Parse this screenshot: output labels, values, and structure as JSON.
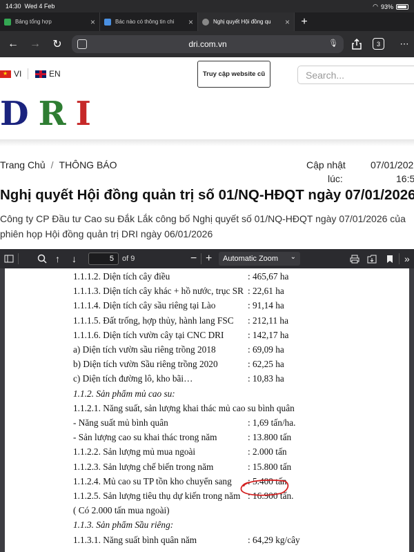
{
  "status_bar": {
    "time": "14:30",
    "date": "Wed 4 Feb",
    "battery": "93%"
  },
  "tabs": [
    {
      "label": "Bảng tổng hợp",
      "icon_color": "#34a853",
      "active": false
    },
    {
      "label": "Bác nào có thông tin chi",
      "icon_color": "#4a90e2",
      "active": false
    },
    {
      "label": "Nghị quyết Hội đồng qu",
      "icon_color": "#888888",
      "active": true
    }
  ],
  "new_tab": "+",
  "toolbar": {
    "url": "dri.com.vn",
    "tab_count": "3"
  },
  "site": {
    "lang_vi": "VI",
    "lang_en": "EN",
    "old_site_button": "Truy cập website cũ",
    "search_placeholder": "Search...",
    "logo": {
      "d": "D",
      "r": "R",
      "i": "I"
    }
  },
  "breadcrumb": {
    "home": "Trang Chủ",
    "separator": "/",
    "current": "THÔNG BÁO"
  },
  "meta": {
    "updated_label": "Cập nhật",
    "updated_value": "07/01/202",
    "time_label": "lúc:",
    "time_value": "16:5"
  },
  "article": {
    "title": "Nghị quyết Hội đồng quản trị số 01/NQ-HĐQT ngày 07/01/2026",
    "summary": "Công ty CP Đầu tư Cao su Đắk Lắk công bố Nghị quyết số 01/NQ-HĐQT ngày 07/01/2026 của phiên họp Hội đồng quản trị DRI ngày 06/01/2026"
  },
  "pdf": {
    "page_number": "5",
    "page_count": "of 9",
    "zoom": "Automatic Zoom",
    "lines": [
      {
        "label": "1.1.1.2. Diện tích cây điều",
        "value": ": 465,67 ha",
        "italic": false
      },
      {
        "label": "1.1.1.3. Diện tích cây khác + hồ nước, trục SR",
        "value": ": 22,61 ha",
        "italic": false
      },
      {
        "label": "1.1.1.4. Diện tích cây sầu riêng tại Lào",
        "value": ": 91,14 ha",
        "italic": false
      },
      {
        "label": "1.1.1.5.  Đất trống, hợp thủy, hành lang FSC",
        "value": ": 212,11 ha",
        "italic": false
      },
      {
        "label": "1.1.1.6. Diện tích vườn cây tại CNC DRI",
        "value": ": 142,17 ha",
        "italic": false
      },
      {
        "label": "a) Diện tích vườn sầu riêng trồng 2018",
        "value": ": 69,09 ha",
        "italic": false
      },
      {
        "label": "b) Diện tích vườn Sầu riêng trồng 2020",
        "value": ": 62,25 ha",
        "italic": false
      },
      {
        "label": "c) Diện tích đường lô, kho bãi…",
        "value": ": 10,83 ha",
        "italic": false
      },
      {
        "label": "1.1.2. Sản phẩm mủ cao su:",
        "value": "",
        "italic": true
      },
      {
        "label": "1.1.2.1. Năng suất, sản lượng khai thác mủ cao su bình quân",
        "value": "",
        "italic": false
      },
      {
        "label": "- Năng suất mủ bình quân",
        "value": ": 1,69 tấn/ha.",
        "italic": false
      },
      {
        "label": "- Sản lượng cao su khai thác trong năm",
        "value": ": 13.800 tấn",
        "italic": false
      },
      {
        "label": "1.1.2.2. Sản lượng mủ mua ngoài",
        "value": ": 2.000 tấn",
        "italic": false
      },
      {
        "label": "1.1.2.3. Sản lượng chế biến trong năm",
        "value": ": 15.800 tấn",
        "italic": false
      },
      {
        "label": "1.1.2.4. Mủ cao su TP tồn kho chuyển sang",
        "value": ": 5.400 tấn",
        "italic": false
      },
      {
        "label": "1.1.2.5. Sản lượng tiêu thụ dự kiến trong năm",
        "value": ": 16.900 tấn.",
        "italic": false
      },
      {
        "label": "( Có 2.000 tấn mua ngoài)",
        "value": "",
        "italic": false
      },
      {
        "label": "1.1.3. Sản phẩm Sầu riêng:",
        "value": "",
        "italic": true
      },
      {
        "label": "1.1.3.1. Năng suất bình quân năm",
        "value": ": 64,29 kg/cây",
        "italic": false
      }
    ]
  }
}
